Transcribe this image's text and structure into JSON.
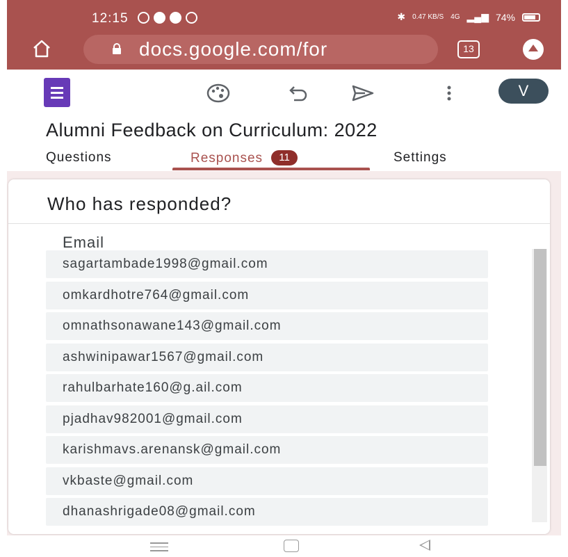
{
  "status_bar": {
    "time": "12:15",
    "network_speed": "0.47 KB/S",
    "network_type": "4G",
    "battery": "74%"
  },
  "browser": {
    "url": "docs.google.com/for",
    "tab_count": "13",
    "icons": [
      "home-icon",
      "lock-icon",
      "tabs-icon",
      "menu-icon"
    ]
  },
  "toolbar": {
    "icons": [
      "forms-logo",
      "palette-icon",
      "undo-icon",
      "send-icon",
      "more-vert-icon"
    ],
    "avatar_letter": "V"
  },
  "form": {
    "title": "Alumni Feedback on Curriculum: 2022"
  },
  "tabs": [
    {
      "label": "Questions",
      "active": false
    },
    {
      "label": "Responses",
      "active": true,
      "badge": "11"
    },
    {
      "label": "Settings",
      "active": false
    }
  ],
  "responders": {
    "title": "Who has responded?",
    "column_header": "Email",
    "emails": [
      "sagartambade1998@gmail.com",
      "omkardhotre764@gmail.com",
      "omnathsonawane143@gmail.com",
      "ashwinipawar1567@gmail.com",
      "rahulbarhate160@g.ail.com",
      "pjadhav982001@gmail.com",
      "karishmavs.arenansk@gmail.com",
      "vkbaste@gmail.com",
      "dhanashrigade08@gmail.com"
    ]
  },
  "colors": {
    "chrome": "#a9524f",
    "accent": "#a9524f",
    "badge": "#8f2e2a",
    "forms_purple": "#673ab7",
    "avatar": "#3c4f5c"
  }
}
